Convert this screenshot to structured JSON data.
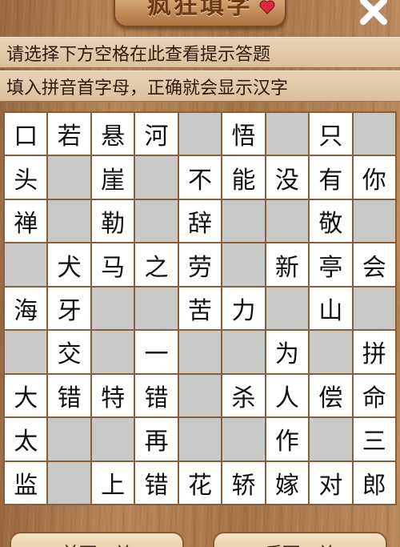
{
  "header": {
    "title": "疯狂填字",
    "hint_line1": "请选择下方空格在此查看提示答题",
    "hint_line2": "填入拼音首字母，正确就会显示汉字"
  },
  "grid": [
    [
      "口",
      "若",
      "悬",
      "河",
      "",
      "悟",
      "",
      "只",
      ""
    ],
    [
      "头",
      "",
      "崖",
      "",
      "不",
      "能",
      "没",
      "有",
      "你"
    ],
    [
      "禅",
      "",
      "勒",
      "",
      "辞",
      "",
      "",
      "敬",
      ""
    ],
    [
      "",
      "犬",
      "马",
      "之",
      "劳",
      "",
      "新",
      "亭",
      "会"
    ],
    [
      "海",
      "牙",
      "",
      "",
      "苦",
      "力",
      "",
      "山",
      ""
    ],
    [
      "",
      "交",
      "",
      "一",
      "",
      "",
      "为",
      "",
      "拼"
    ],
    [
      "大",
      "错",
      "特",
      "错",
      "",
      "杀",
      "人",
      "偿",
      "命"
    ],
    [
      "太",
      "",
      "",
      "再",
      "",
      "",
      "作",
      "",
      "三"
    ],
    [
      "监",
      "",
      "上",
      "错",
      "花",
      "轿",
      "嫁",
      "对",
      "郎"
    ]
  ],
  "footer": {
    "prev_label": "前面一关",
    "next_label": "后面一关"
  },
  "colors": {
    "cell_filled": "#ffffff",
    "cell_empty": "#c9c9c9",
    "grid_line": "#8b5e3a"
  }
}
